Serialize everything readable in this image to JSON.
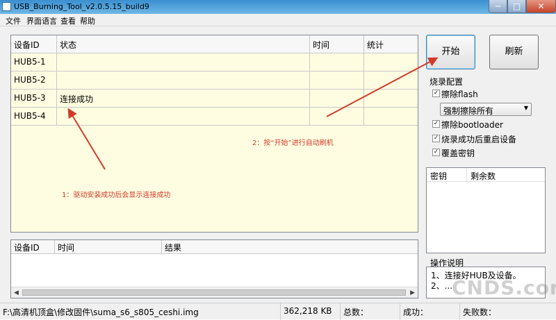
{
  "window": {
    "title": "USB_Burning_Tool_v2.0.5.15_build9",
    "min": "─",
    "max": "□",
    "close": "✕"
  },
  "menu": [
    "文件",
    "界面语言",
    "查看",
    "帮助"
  ],
  "device_table": {
    "headers": [
      "设备ID",
      "状态",
      "时间",
      "统计"
    ],
    "rows": [
      [
        "HUB5-1",
        "",
        "",
        ""
      ],
      [
        "HUB5-2",
        "",
        "",
        ""
      ],
      [
        "HUB5-3",
        "连接成功",
        "",
        ""
      ],
      [
        "HUB5-4",
        "",
        "",
        ""
      ]
    ]
  },
  "log_table": {
    "headers": [
      "设备ID",
      "时间",
      "结果"
    ]
  },
  "buttons": {
    "start": "开始",
    "refresh": "刷新"
  },
  "config": {
    "title": "烧录配置",
    "erase_flash": "擦除flash",
    "erase_mode": "强制擦除所有",
    "erase_bootloader": "擦除bootloader",
    "reset_after_success": "烧录成功后重启设备",
    "overwrite_key": "覆盖密钥",
    "checkmark": "✓"
  },
  "key_table": {
    "headers": [
      "密钥",
      "剩余数"
    ]
  },
  "help": {
    "title": "操作说明",
    "lines": [
      "1、连接好HUB及设备。",
      "2、..."
    ]
  },
  "annotations": {
    "note1": "1：驱动安装成功后会显示连接成功",
    "note2": "2：按“开始”进行自动刷机",
    "color": "#d23a2a"
  },
  "watermark": "CNDS.com",
  "status": {
    "path": "F:\\高清机顶盒\\修改固件\\suma_s6_s805_ceshi.img",
    "size": "362,218 KB",
    "total": "总数：",
    "success": "成功：",
    "fail": "失败数："
  }
}
